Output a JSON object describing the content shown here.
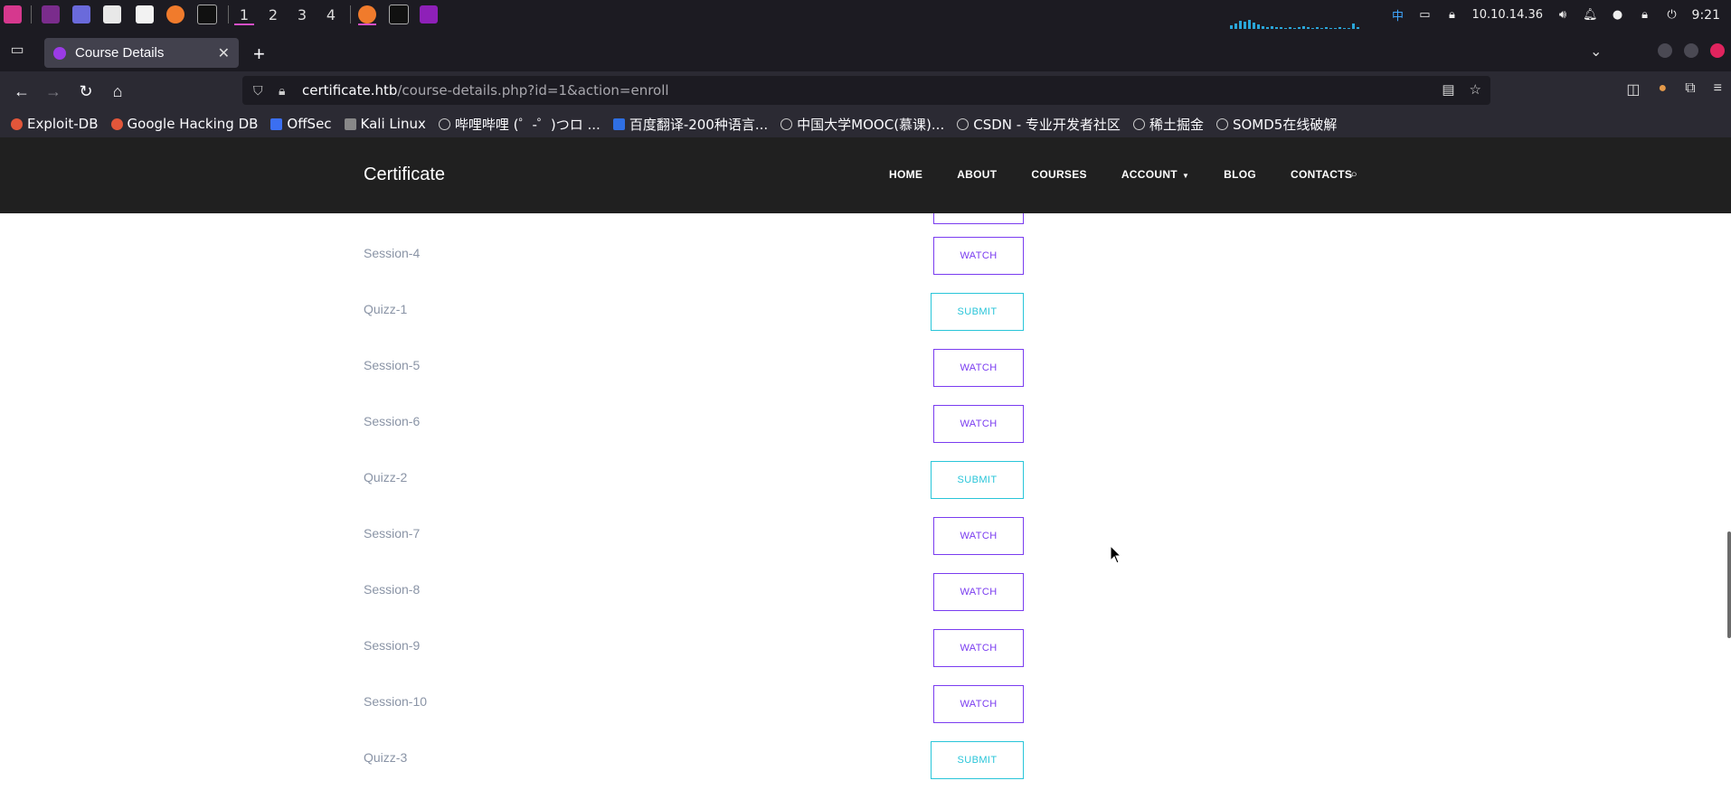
{
  "taskbar": {
    "workspaces": [
      "1",
      "2",
      "3",
      "4"
    ],
    "ip_label": "10.10.14.36",
    "clock": "9:21",
    "input_method": "中"
  },
  "browser": {
    "tab_title": "Course Details",
    "url_host": "certificate.htb",
    "url_path": "/course-details.php?id=1&action=enroll",
    "bookmarks": [
      {
        "label": "Exploit-DB",
        "icon_color": "#e2563a"
      },
      {
        "label": "Google Hacking DB",
        "icon_color": "#e2563a"
      },
      {
        "label": "OffSec",
        "icon_color": "#3b6ff2"
      },
      {
        "label": "Kali Linux",
        "icon_color": "#cccccc"
      },
      {
        "label": "哔哩哔哩 (゜-゜)つロ ...",
        "icon_color": "#cccccc"
      },
      {
        "label": "百度翻译-200种语言...",
        "icon_color": "#2f6fe3"
      },
      {
        "label": "中国大学MOOC(慕课)...",
        "icon_color": "#cccccc"
      },
      {
        "label": "CSDN - 专业开发者社区",
        "icon_color": "#cccccc"
      },
      {
        "label": "稀土掘金",
        "icon_color": "#cccccc"
      },
      {
        "label": "SOMD5在线破解",
        "icon_color": "#cccccc"
      }
    ]
  },
  "site": {
    "brand": "Certificate",
    "menu": [
      "HOME",
      "ABOUT",
      "COURSES",
      "ACCOUNT",
      "BLOG",
      "CONTACTS"
    ]
  },
  "course": {
    "items": [
      {
        "label": "Session-4",
        "action": "WATCH",
        "kind": "watch"
      },
      {
        "label": "Quizz-1",
        "action": "SUBMIT",
        "kind": "submit"
      },
      {
        "label": "Session-5",
        "action": "WATCH",
        "kind": "watch"
      },
      {
        "label": "Session-6",
        "action": "WATCH",
        "kind": "watch"
      },
      {
        "label": "Quizz-2",
        "action": "SUBMIT",
        "kind": "submit"
      },
      {
        "label": "Session-7",
        "action": "WATCH",
        "kind": "watch"
      },
      {
        "label": "Session-8",
        "action": "WATCH",
        "kind": "watch"
      },
      {
        "label": "Session-9",
        "action": "WATCH",
        "kind": "watch"
      },
      {
        "label": "Session-10",
        "action": "WATCH",
        "kind": "watch"
      },
      {
        "label": "Quizz-3",
        "action": "SUBMIT",
        "kind": "submit"
      }
    ]
  },
  "colors": {
    "watch": "#7a3cf0",
    "submit": "#29c5d9",
    "header_bg": "#202020"
  }
}
